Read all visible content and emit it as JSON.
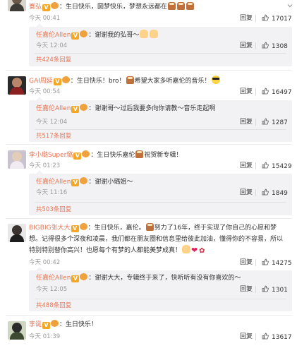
{
  "labels": {
    "reply": "回复"
  },
  "icons": {
    "verified": "V",
    "heart": "❤",
    "rose": "✿"
  },
  "colors": {
    "username": "#eb7350",
    "link": "#eb7350",
    "meta": "#999999",
    "subbox_bg": "#f2f2f5"
  },
  "comments": [
    {
      "user": "寰弘",
      "sep": "：",
      "text_a": "生日快乐，圆梦快乐，梦想永远都在",
      "time": "今天 00:41",
      "likes": "17017",
      "reply": {
        "user": "任嘉伦Allen",
        "sep": "：",
        "text_a": "谢谢我的弘哥～",
        "time": "今天 12:04",
        "likes": "1308",
        "more": "共424条回复"
      }
    },
    {
      "user": "GAI周延",
      "sep": "：",
      "text_a": "生日快乐！bro！",
      "text_b": "希望大家多听嘉伦的音乐！",
      "time": "今天 00:54",
      "likes": "16497",
      "reply": {
        "user": "任嘉伦Allen",
        "sep": "：",
        "text_a": "谢谢哥～过后我要多向你请教～音乐走起啊",
        "time": "今天 12:04",
        "likes": "1287",
        "more": "共517条回复"
      }
    },
    {
      "user": "李小璐Super璐",
      "sep": "：",
      "text_a": "生日快乐嘉伦",
      "text_b": "祝贺新专辑！",
      "time": "今天 01:23",
      "likes": "15429",
      "reply": {
        "user": "任嘉伦Allen",
        "sep": "：",
        "text_a": "谢谢小璐姐～",
        "time": "今天 11:16",
        "likes": "1849",
        "more": "共503条回复"
      }
    },
    {
      "user": "BIGBIG张大大",
      "sep": "：",
      "text_a": "生日快乐，嘉伦。",
      "text_b": "努力了16年，终于实现了你自己的心愿和梦想。记得很多个深夜和凌晨，我们都在朋友圈和信息里给彼此加油，懂得你的不容易，所以特别特别替你高兴！也愿每个有梦的人都能美梦成真！",
      "time": "今天 00:42",
      "likes": "14275",
      "reply": {
        "user": "任嘉伦Allen",
        "sep": "：",
        "text_a": "谢谢大大，专辑终于来了，快听听有没有你喜欢的～",
        "time": "今天 12:05",
        "likes": "1301",
        "more": "共488条回复"
      }
    },
    {
      "user": "李诞",
      "sep": "：",
      "text_a": "生日快乐！",
      "time": "今天 01:39",
      "likes": "13617"
    }
  ]
}
